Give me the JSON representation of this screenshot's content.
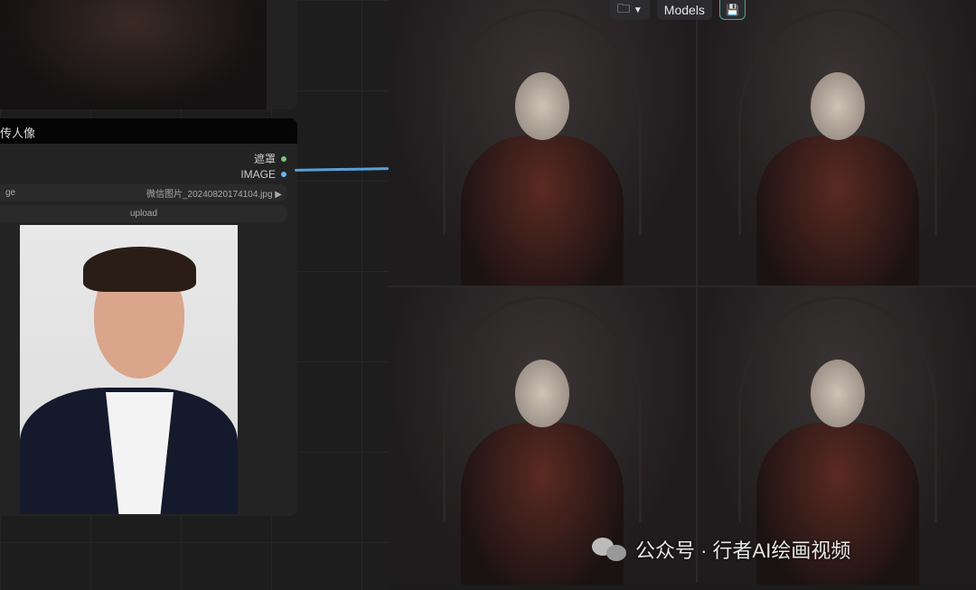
{
  "node": {
    "title": "传人像",
    "outputs": [
      {
        "label": "遮罩",
        "color": "#7bc47f"
      },
      {
        "label": "IMAGE",
        "color": "#64b5f6"
      }
    ],
    "image_widget": {
      "label": "ge",
      "value": "微信图片_20240820174104.jpg"
    },
    "upload_label": "upload"
  },
  "toolbar": {
    "folder_icon": "folder-icon",
    "models_label": "Models",
    "save_icon": "save-icon"
  },
  "watermark": "公众号 · 行者AI绘画视频"
}
